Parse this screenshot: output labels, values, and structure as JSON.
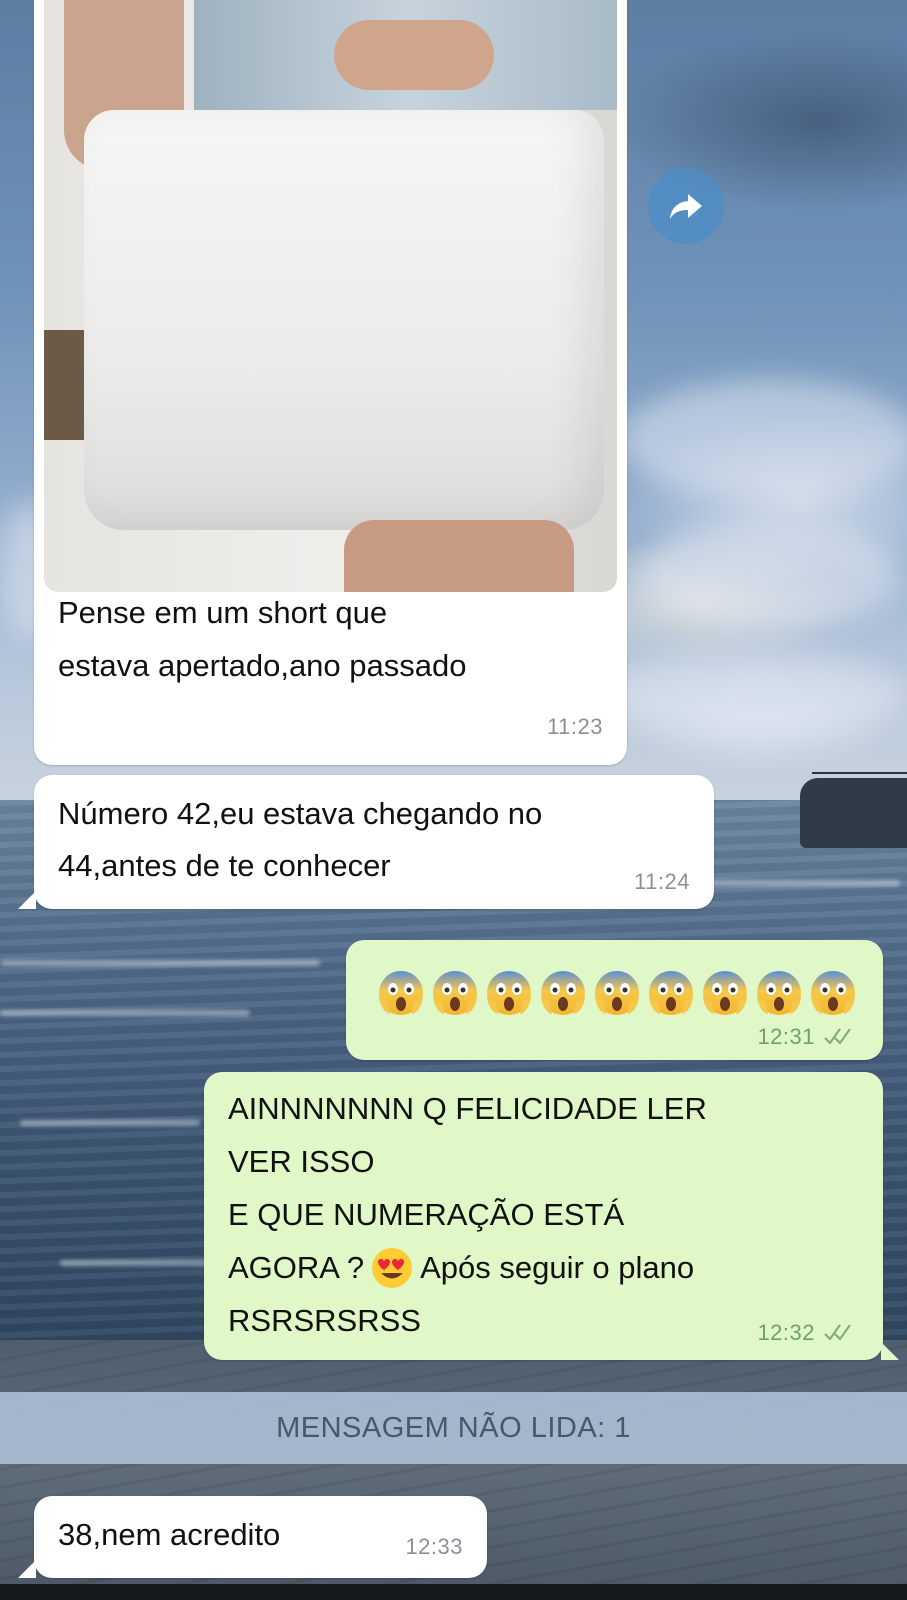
{
  "messages": [
    {
      "direction": "in",
      "text_lines": [
        "Pense em um short que",
        "estava apertado,ano passado"
      ],
      "time": "11:23",
      "has_photo": true
    },
    {
      "direction": "in",
      "text_lines": [
        "Número 42,eu estava chegando no",
        "44,antes de te conhecer"
      ],
      "time": "11:24"
    },
    {
      "direction": "out",
      "emoji": "screaming-face",
      "emoji_count": 9,
      "time": "12:31",
      "status": "read"
    },
    {
      "direction": "out",
      "text_lines": [
        "AINNNNNNN Q FELICIDADE LER",
        "VER ISSO",
        "E QUE NUMERAÇÃO ESTÁ",
        "AGORA ?",
        "Após seguir o plano",
        "RSRSRSRSS"
      ],
      "inline_emoji": "heart-eyes-face",
      "time": "12:32",
      "status": "read"
    },
    {
      "direction": "in",
      "text": "38,nem acredito",
      "time": "12:33"
    }
  ],
  "unread_divider": "MENSAGEM NÃO LIDA: 1",
  "icons": {
    "forward": "forward-arrow-icon",
    "read_ticks": "double-check-icon"
  },
  "colors": {
    "incoming_bubble": "#ffffff",
    "outgoing_bubble": "#e0f7c7",
    "forward_button": "#4c8cc8"
  }
}
